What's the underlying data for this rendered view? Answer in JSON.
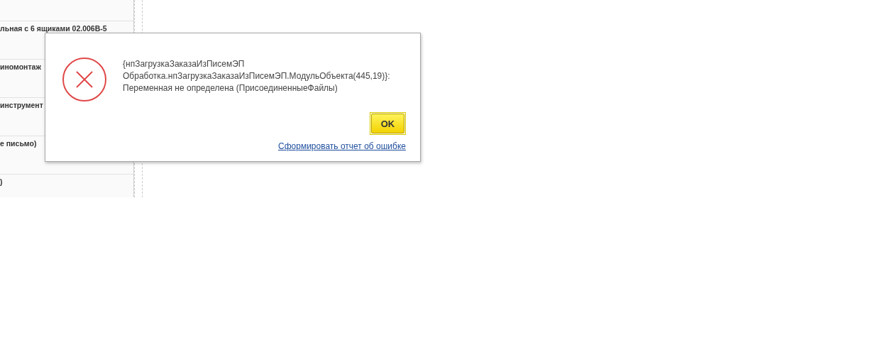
{
  "list": {
    "rows": [
      {
        "text": "льная с 6 ящиками 02.006В-5"
      },
      {
        "text": "иномонтаж"
      },
      {
        "text": "инструмент"
      },
      {
        "text": "е письмо)"
      },
      {
        "text": ")"
      }
    ]
  },
  "dialog": {
    "kind": "error",
    "message_lines": [
      "{нпЗагрузкаЗаказаИзПисемЭП",
      "Обработка.нпЗагрузкаЗаказаИзПисемЭП.МодульОбъекта(445,19)}:",
      "Переменная не определена (ПрисоединенныеФайлы)"
    ],
    "button": "OK",
    "link": "Сформировать отчет об ошибке"
  }
}
